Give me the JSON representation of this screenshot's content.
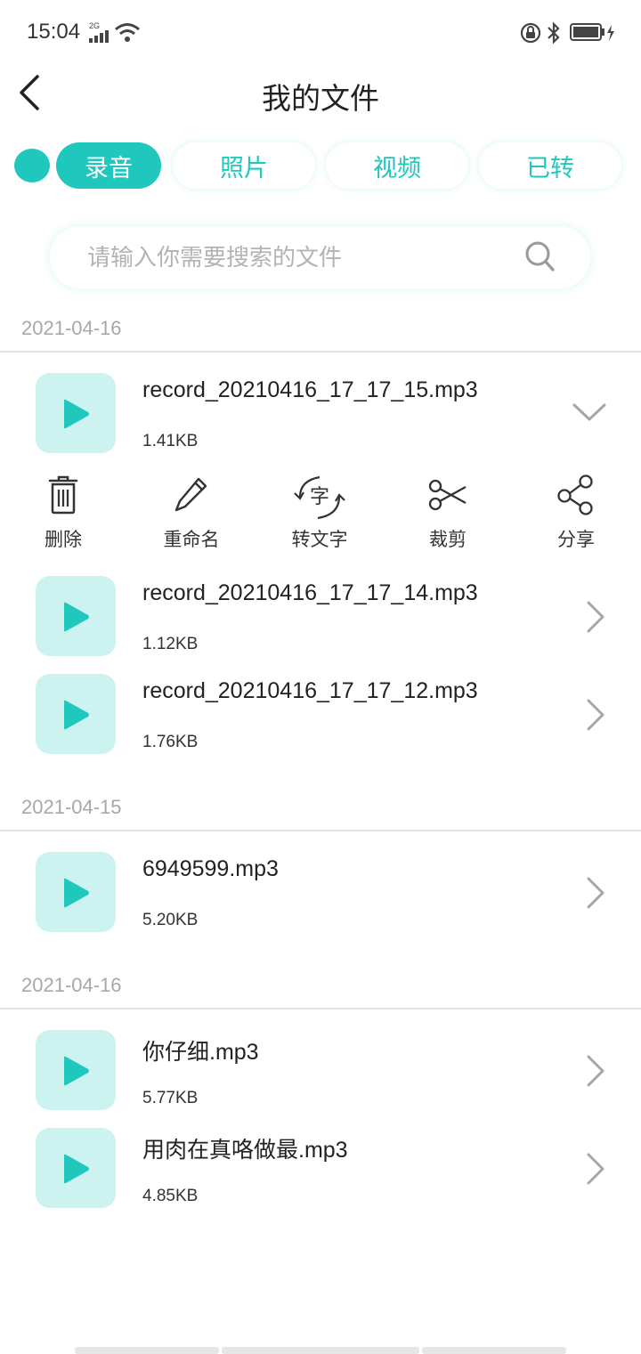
{
  "status_bar": {
    "time": "15:04",
    "network": "2G"
  },
  "header": {
    "title": "我的文件"
  },
  "tabs": [
    {
      "label": "录音",
      "active": true
    },
    {
      "label": "照片",
      "active": false
    },
    {
      "label": "视频",
      "active": false
    },
    {
      "label": "已转",
      "active": false
    }
  ],
  "search": {
    "placeholder": "请输入你需要搜索的文件",
    "value": ""
  },
  "groups": [
    {
      "date": "2021-04-16",
      "files": [
        {
          "name": "record_20210416_17_17_15.mp3",
          "size": "1.41KB",
          "expanded": true
        },
        {
          "name": "record_20210416_17_17_14.mp3",
          "size": "1.12KB",
          "expanded": false
        },
        {
          "name": "record_20210416_17_17_12.mp3",
          "size": "1.76KB",
          "expanded": false
        }
      ]
    },
    {
      "date": "2021-04-15",
      "files": [
        {
          "name": "6949599.mp3",
          "size": "5.20KB",
          "expanded": false
        }
      ]
    },
    {
      "date": "2021-04-16",
      "files": [
        {
          "name": "你仔细.mp3",
          "size": "5.77KB",
          "expanded": false
        },
        {
          "name": "用肉在真咯做最.mp3",
          "size": "4.85KB",
          "expanded": false
        }
      ]
    }
  ],
  "actions": [
    {
      "label": "删除",
      "icon": "trash-icon"
    },
    {
      "label": "重命名",
      "icon": "pencil-icon"
    },
    {
      "label": "转文字",
      "icon": "convert-text-icon",
      "glyph": "字"
    },
    {
      "label": "裁剪",
      "icon": "scissors-icon"
    },
    {
      "label": "分享",
      "icon": "share-icon"
    }
  ],
  "colors": {
    "accent": "#1fc7bd",
    "thumb_bg": "#cdf3f0",
    "divider": "#e3e3e3",
    "date_text": "#a8a8a8"
  }
}
